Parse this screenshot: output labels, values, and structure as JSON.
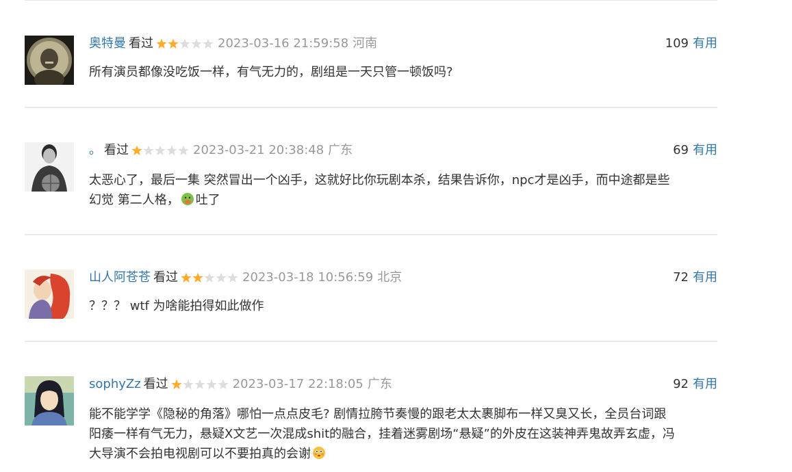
{
  "comments": [
    {
      "user": "奥特曼",
      "status": "看过",
      "rating": 2,
      "time": "2023-03-16 21:59:58",
      "location": "河南",
      "votes": "109",
      "useful_label": "有用",
      "content": [
        "所有演员都像没吃饭一样，有气无力的，剧组是一天只管一顿饭吗?"
      ]
    },
    {
      "user": "。",
      "status": "看过",
      "rating": 1,
      "time": "2023-03-21 20:38:48",
      "location": "广东",
      "votes": "69",
      "useful_label": "有用",
      "content": [
        "太恶心了，最后一集 突然冒出一个凶手，这就好比你玩剧本杀，结果告诉你，npc才是凶手，而中途都是些",
        "幻觉 第二人格，",
        "吐了"
      ]
    },
    {
      "user": "山人阿苍苍",
      "status": "看过",
      "rating": 2,
      "time": "2023-03-18 10:56:59",
      "location": "北京",
      "votes": "72",
      "useful_label": "有用",
      "content": [
        "？？？ wtf 为啥能拍得如此做作"
      ]
    },
    {
      "user": "sophyZz",
      "status": "看过",
      "rating": 1,
      "time": "2023-03-17 22:18:05",
      "location": "广东",
      "votes": "92",
      "useful_label": "有用",
      "content": [
        "能不能学学《隐秘的角落》哪怕一点点皮毛? 剧情拉胯节奏慢的跟老太太裹脚布一样又臭又长，全员台词跟",
        "阳痿一样有气无力，悬疑X文艺一次混成shit的融合，挂着迷雾剧场“悬疑”的外皮在这装神弄鬼故弄玄虚，冯",
        "大导演不会拍电视剧可以不要拍真的会谢"
      ]
    }
  ],
  "colors": {
    "link": "#3377aa",
    "meta": "#999999",
    "star_on": "#ffac2d",
    "star_off": "#dddddd"
  }
}
